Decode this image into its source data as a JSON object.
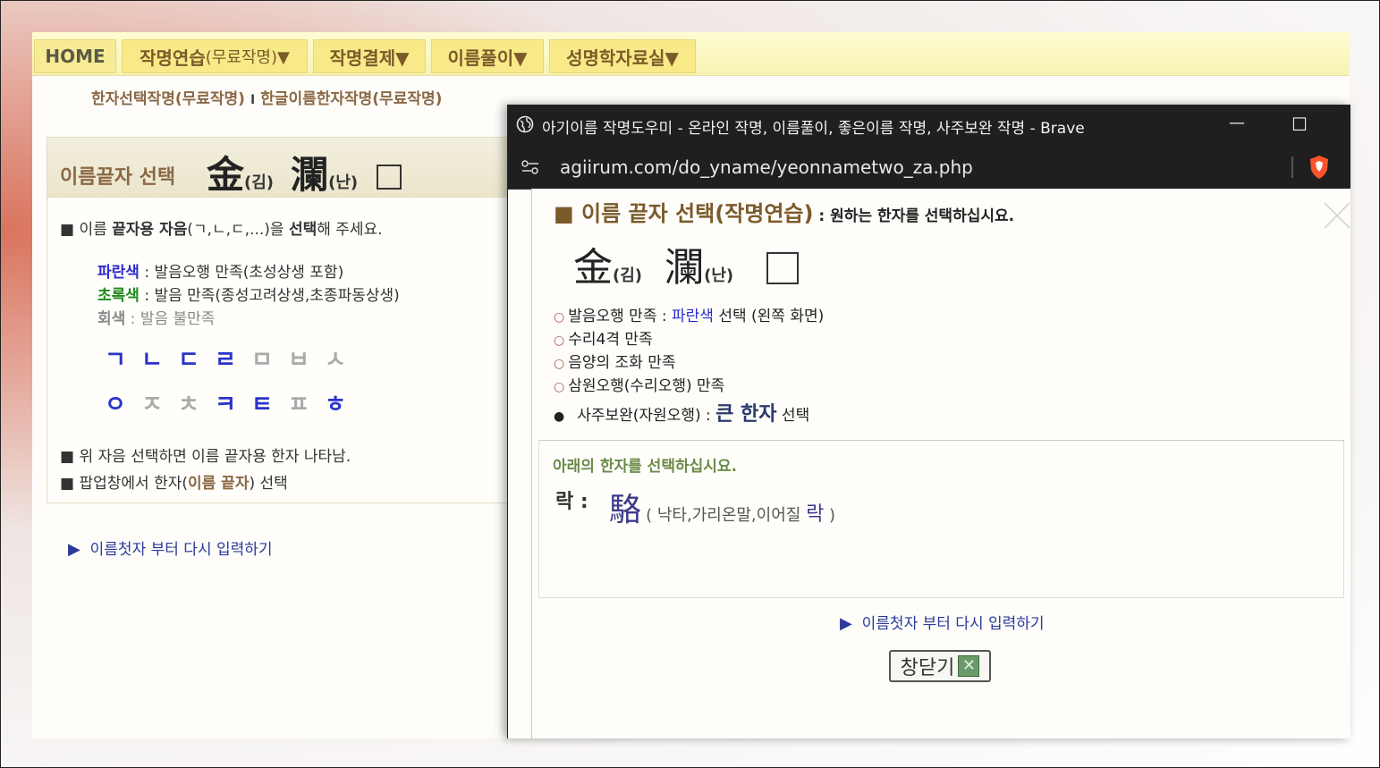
{
  "nav": {
    "home": "HOME",
    "item1_main": "작명연습",
    "item1_sub": "(무료작명)▼",
    "item2": "작명결제▼",
    "item3": "이름풀이▼",
    "item4": "성명학자료실▼"
  },
  "subnav": {
    "link1": "한자선택작명(무료작명)",
    "separator": "I",
    "link2": "한글이름한자작명(무료작명)"
  },
  "panel": {
    "label": "이름끝자 선택",
    "han1": "金",
    "han1_read": "(김)",
    "han2": "瀾",
    "han2_read": "(난)",
    "instr_prefix": "■ 이름 ",
    "instr_bold1": "끝자용 자음",
    "instr_mid": "(ㄱ,ㄴ,ㄷ,...)을 ",
    "instr_bold2": "선택",
    "instr_end": "해 주세요.",
    "legend_blue": "파란색",
    "legend_blue_desc": " : 발음오행 만족(초성상생 포함)",
    "legend_green": "초록색",
    "legend_green_desc": " : 발음 만족(종성고려상생,초종파동상생)",
    "legend_gray": "회색",
    "legend_gray_desc": " : 발음 불만족",
    "jamo_row1": [
      "ㄱ",
      "ㄴ",
      "ㄷ",
      "ㄹ",
      "ㅁ",
      "ㅂ",
      "ㅅ"
    ],
    "jamo_row2": [
      "ㅇ",
      "ㅈ",
      "ㅊ",
      "ㅋ",
      "ㅌ",
      "ㅍ",
      "ㅎ"
    ],
    "note1": "■ 위 자음 선택하면 이름 끝자용 한자 나타남.",
    "note2_prefix": "■ 팝업창에서 한자(",
    "note2_bold": "이름 끝자",
    "note2_end": ") 선택"
  },
  "redo_link": "이름첫자 부터 다시 입력하기",
  "popup": {
    "window_title": "아기이름 작명도우미 - 온라인 작명, 이름풀이, 좋은이름 작명, 사주보완 작명 - Brave",
    "url": "agiirum.com/do_yname/yeonnametwo_za.php",
    "minimize": "—",
    "maximize": "☐",
    "head_main": "■ 이름 끝자 선택(작명연습)",
    "head_sub": " : 원하는 한자를 선택하십시요.",
    "han1": "金",
    "han1_read": "(김)",
    "han2": "瀾",
    "han2_read": "(난)",
    "crit1_a": "발음오행 만족 : ",
    "crit1_blue": "파란색",
    "crit1_b": " 선택 (왼쪽 화면)",
    "crit2": "수리4격 만족",
    "crit3": "음양의 조화 만족",
    "crit4": "삼원오행(수리오행) 만족",
    "crit5_a": "사주보완(자원오행) : ",
    "crit5_big": "큰 한자",
    "crit5_b": " 선택",
    "select_prompt": "아래의 한자를 선택하십시요.",
    "syllable": "락 :",
    "hanja": "駱",
    "hanja_meaning_open": "( 낙타,가리온말,이어질 ",
    "hanja_meaning_read": "락",
    "hanja_meaning_close": " )",
    "redo_link": "이름첫자 부터 다시 입력하기",
    "close_button": "창닫기"
  },
  "colors": {
    "nav_bg": "#f8ea88",
    "accent_brown": "#8a6845",
    "blue_jamo": "#2b33c9",
    "gray_jamo": "#aaaaaa",
    "popup_titlebar": "#1f1f1f",
    "brave_orange": "#fb542b"
  }
}
